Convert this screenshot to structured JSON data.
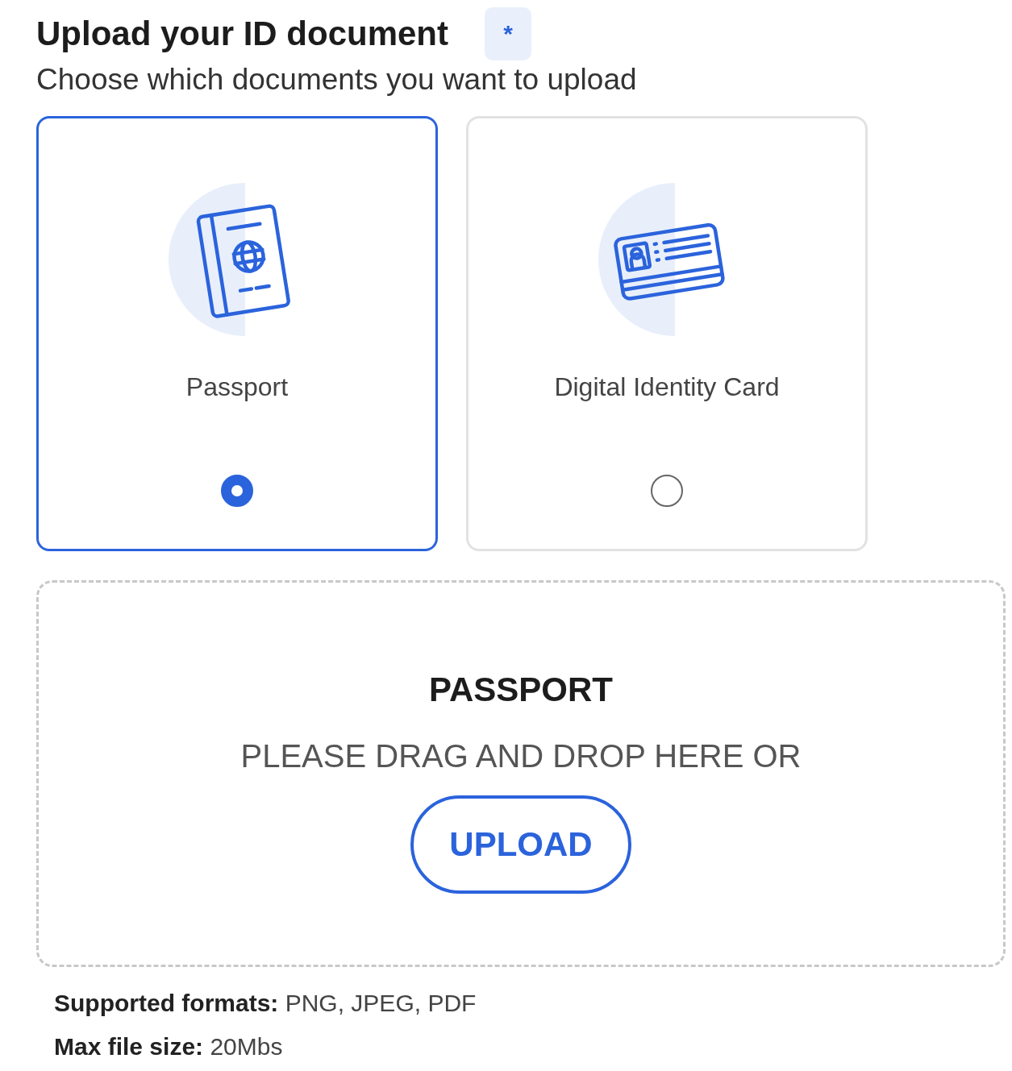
{
  "header": {
    "title": "Upload your ID document",
    "required_mark": "*",
    "subtitle": "Choose which documents you want to upload"
  },
  "options": [
    {
      "kind": "passport",
      "label": "Passport",
      "selected": true
    },
    {
      "kind": "id-card",
      "label": "Digital Identity Card",
      "selected": false
    }
  ],
  "dropzone": {
    "title": "PASSPORT",
    "instruction": "PLEASE DRAG AND DROP HERE OR",
    "button": "UPLOAD"
  },
  "notes": [
    "**Supported formats:** PNG, JPEG, PDF",
    "**Max file size:** 20Mbs"
  ]
}
